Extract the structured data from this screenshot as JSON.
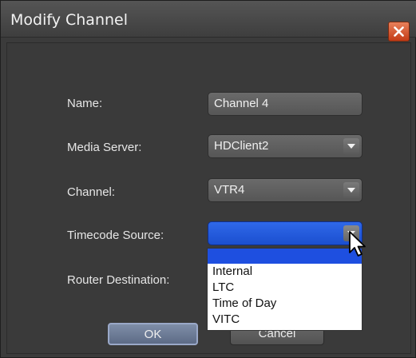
{
  "dialog": {
    "title": "Modify Channel",
    "close_icon": "close-icon"
  },
  "form": {
    "name_label": "Name:",
    "name_value": "Channel 4",
    "media_server_label": "Media Server:",
    "media_server_value": "HDClient2",
    "channel_label": "Channel:",
    "channel_value": "VTR4",
    "timecode_label": "Timecode Source:",
    "timecode_value": "",
    "router_label": "Router Destination:"
  },
  "timecode_options": [
    "Internal",
    "LTC",
    "Time of Day",
    "VITC"
  ],
  "buttons": {
    "ok": "OK",
    "cancel": "Cancel"
  },
  "colors": {
    "dialog_bg": "#3b3b3b",
    "close_accent": "#d9532a",
    "selection_blue": "#1e4fe0"
  }
}
